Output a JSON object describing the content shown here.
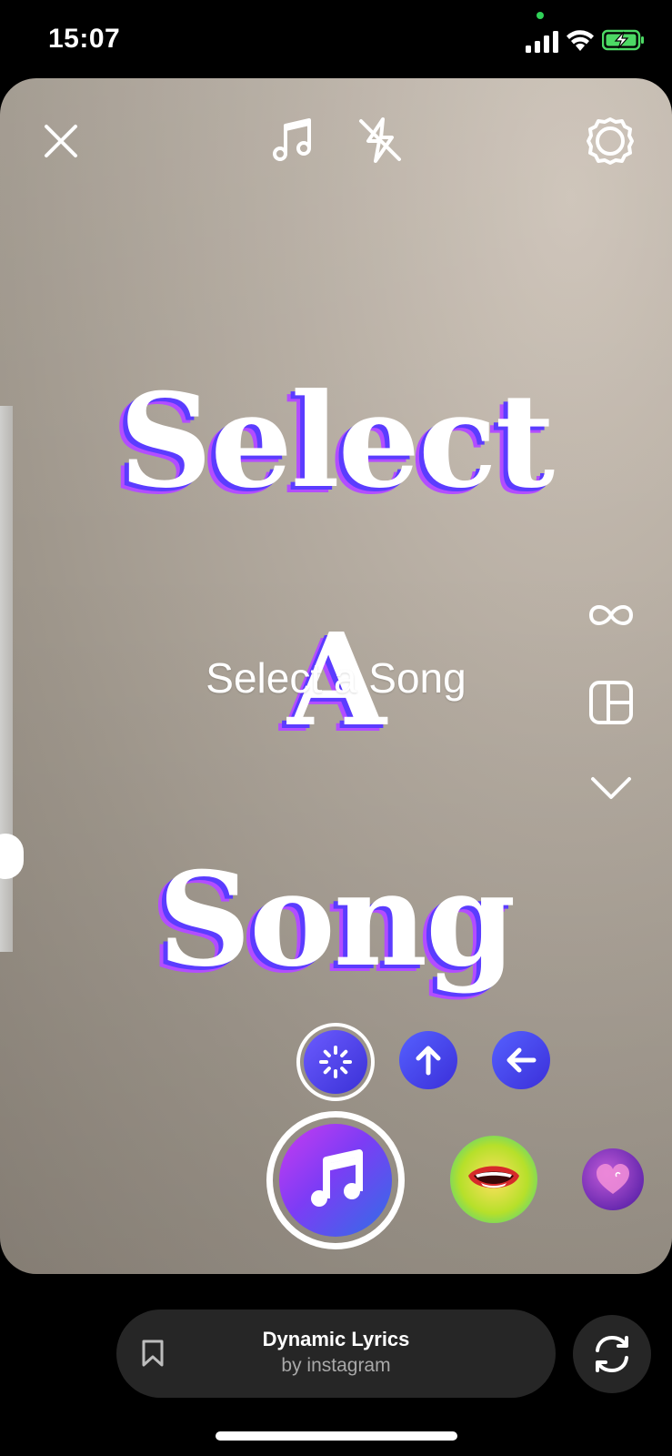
{
  "status_bar": {
    "time": "15:07",
    "icons": [
      "signal-icon",
      "wifi-icon",
      "battery-charging-icon"
    ],
    "battery_color": "#4cd964"
  },
  "camera": {
    "top_controls": [
      "close-icon",
      "music-note-icon",
      "flash-off-icon",
      "settings-icon"
    ],
    "effect_words": [
      "Select",
      "A",
      "Song"
    ],
    "prompt": "Select a Song",
    "side_tools": [
      "boomerang-icon",
      "layout-icon",
      "chevron-down-icon"
    ],
    "mini_effects": [
      "loading-icon",
      "arrow-up-icon",
      "arrow-left-icon"
    ],
    "effects_tray": [
      "music-note-effect",
      "mouth-effect",
      "hearts-effect"
    ]
  },
  "effect_info": {
    "name": "Dynamic Lyrics",
    "author": "by instagram"
  },
  "colors": {
    "accent_purple": "#7d3cf5",
    "accent_blue": "#3b2fd9",
    "pill_bg": "#262626"
  }
}
